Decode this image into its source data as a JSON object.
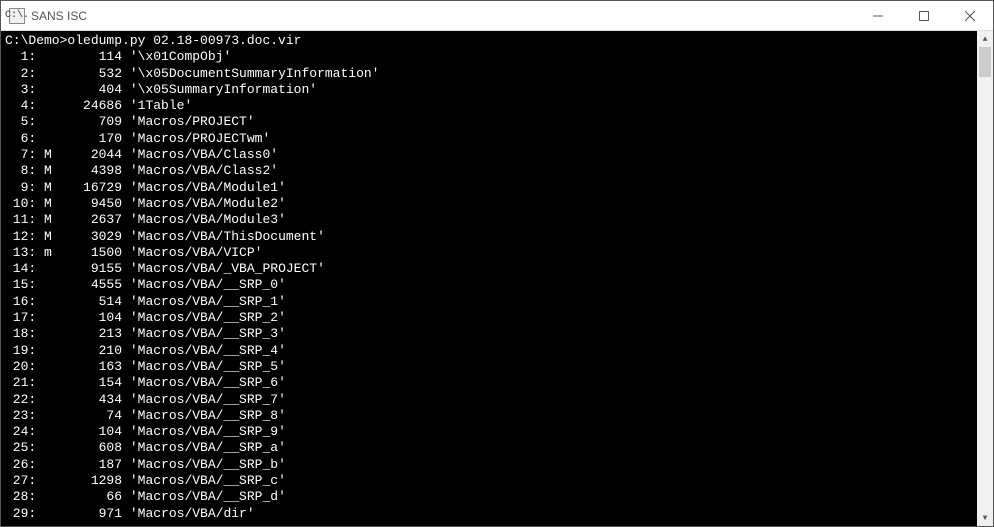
{
  "window": {
    "title": "SANS ISC",
    "icon_label": "C:\\."
  },
  "prompt": "C:\\Demo>",
  "command": "oledump.py 02.18-00973.doc.vir",
  "rows": [
    {
      "idx": "1",
      "flag": "",
      "size": "114",
      "name": "'\\x01CompObj'"
    },
    {
      "idx": "2",
      "flag": "",
      "size": "532",
      "name": "'\\x05DocumentSummaryInformation'"
    },
    {
      "idx": "3",
      "flag": "",
      "size": "404",
      "name": "'\\x05SummaryInformation'"
    },
    {
      "idx": "4",
      "flag": "",
      "size": "24686",
      "name": "'1Table'"
    },
    {
      "idx": "5",
      "flag": "",
      "size": "709",
      "name": "'Macros/PROJECT'"
    },
    {
      "idx": "6",
      "flag": "",
      "size": "170",
      "name": "'Macros/PROJECTwm'"
    },
    {
      "idx": "7",
      "flag": "M",
      "size": "2044",
      "name": "'Macros/VBA/Class0'"
    },
    {
      "idx": "8",
      "flag": "M",
      "size": "4398",
      "name": "'Macros/VBA/Class2'"
    },
    {
      "idx": "9",
      "flag": "M",
      "size": "16729",
      "name": "'Macros/VBA/Module1'"
    },
    {
      "idx": "10",
      "flag": "M",
      "size": "9450",
      "name": "'Macros/VBA/Module2'"
    },
    {
      "idx": "11",
      "flag": "M",
      "size": "2637",
      "name": "'Macros/VBA/Module3'"
    },
    {
      "idx": "12",
      "flag": "M",
      "size": "3029",
      "name": "'Macros/VBA/ThisDocument'"
    },
    {
      "idx": "13",
      "flag": "m",
      "size": "1500",
      "name": "'Macros/VBA/VICP'"
    },
    {
      "idx": "14",
      "flag": "",
      "size": "9155",
      "name": "'Macros/VBA/_VBA_PROJECT'"
    },
    {
      "idx": "15",
      "flag": "",
      "size": "4555",
      "name": "'Macros/VBA/__SRP_0'"
    },
    {
      "idx": "16",
      "flag": "",
      "size": "514",
      "name": "'Macros/VBA/__SRP_1'"
    },
    {
      "idx": "17",
      "flag": "",
      "size": "104",
      "name": "'Macros/VBA/__SRP_2'"
    },
    {
      "idx": "18",
      "flag": "",
      "size": "213",
      "name": "'Macros/VBA/__SRP_3'"
    },
    {
      "idx": "19",
      "flag": "",
      "size": "210",
      "name": "'Macros/VBA/__SRP_4'"
    },
    {
      "idx": "20",
      "flag": "",
      "size": "163",
      "name": "'Macros/VBA/__SRP_5'"
    },
    {
      "idx": "21",
      "flag": "",
      "size": "154",
      "name": "'Macros/VBA/__SRP_6'"
    },
    {
      "idx": "22",
      "flag": "",
      "size": "434",
      "name": "'Macros/VBA/__SRP_7'"
    },
    {
      "idx": "23",
      "flag": "",
      "size": "74",
      "name": "'Macros/VBA/__SRP_8'"
    },
    {
      "idx": "24",
      "flag": "",
      "size": "104",
      "name": "'Macros/VBA/__SRP_9'"
    },
    {
      "idx": "25",
      "flag": "",
      "size": "608",
      "name": "'Macros/VBA/__SRP_a'"
    },
    {
      "idx": "26",
      "flag": "",
      "size": "187",
      "name": "'Macros/VBA/__SRP_b'"
    },
    {
      "idx": "27",
      "flag": "",
      "size": "1298",
      "name": "'Macros/VBA/__SRP_c'"
    },
    {
      "idx": "28",
      "flag": "",
      "size": "66",
      "name": "'Macros/VBA/__SRP_d'"
    },
    {
      "idx": "29",
      "flag": "",
      "size": "971",
      "name": "'Macros/VBA/dir'"
    }
  ]
}
